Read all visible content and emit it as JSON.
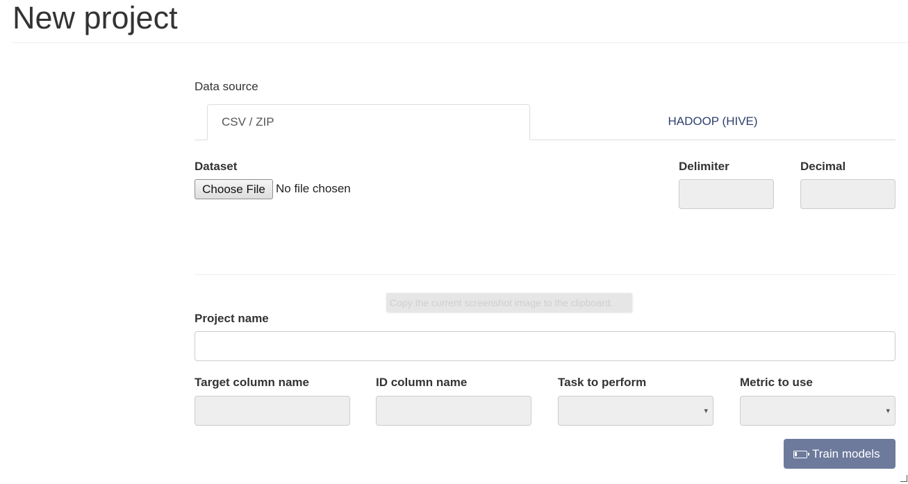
{
  "page": {
    "title": "New project"
  },
  "data_source": {
    "label": "Data source",
    "tabs": [
      {
        "label": "CSV / ZIP",
        "active": true
      },
      {
        "label": "HADOOP (HIVE)",
        "active": false
      }
    ]
  },
  "dataset": {
    "label": "Dataset",
    "file_button_label": "Choose File",
    "file_status": "No file chosen"
  },
  "delimiter": {
    "label": "Delimiter",
    "value": ""
  },
  "decimal": {
    "label": "Decimal",
    "value": ""
  },
  "tooltip": {
    "text": "Copy the current screenshot image to the clipboard."
  },
  "project_name": {
    "label": "Project name",
    "value": ""
  },
  "target_column": {
    "label": "Target column name",
    "value": ""
  },
  "id_column": {
    "label": "ID column name",
    "value": ""
  },
  "task": {
    "label": "Task to perform",
    "selected": "",
    "arrow": "▾"
  },
  "metric": {
    "label": "Metric to use",
    "selected": "",
    "arrow": "▾"
  },
  "train_button": {
    "label": "Train models",
    "icon": "battery-icon"
  },
  "colors": {
    "tab_link": "#2c3e6b",
    "button_primary": "#6d7a9c",
    "disabled_input_bg": "#eeeeee"
  }
}
